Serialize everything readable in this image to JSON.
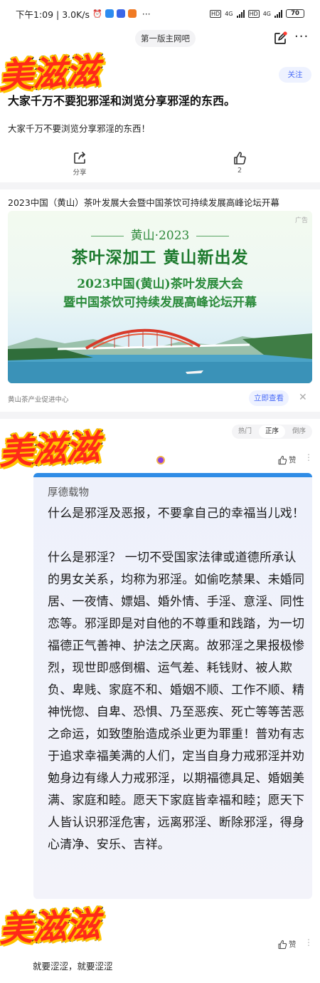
{
  "status_bar": {
    "time_speed": "下午1:09 | 3.0K/s",
    "dots": "···",
    "network_a": "4G",
    "network_b": "4G",
    "battery": "70"
  },
  "nav": {
    "forum_name": "第一版主网吧",
    "more": "···"
  },
  "watermark": "美滋滋",
  "post": {
    "follow_label": "关注",
    "title": "大家千万不要犯邪淫和浏览分享邪淫的东西。",
    "body": "大家千万不要浏览分享邪淫的东西！",
    "share_label": "分享",
    "like_count": "2"
  },
  "ad": {
    "title": "2023中国（黄山）茶叶发展大会暨中国茶饮可持续发展高峰论坛开幕",
    "tag": "广告",
    "banner_line1": "黄山·2023",
    "banner_line2": "茶叶深加工 黄山新出发",
    "banner_line3": "2023中国(黄山)茶叶发展大会",
    "banner_line4": "暨中国茶饮可持续发展高峰论坛开幕",
    "source": "黄山茶产业促进中心",
    "cta": "立即查看",
    "close": "✕"
  },
  "comments_header": {
    "sort_options": [
      "热门",
      "正序",
      "倒序"
    ],
    "active_sort": "正序"
  },
  "first_reply": {
    "like_label": "赞",
    "more": "⋮",
    "quote_heading": "厚德载物",
    "paragraph1": "什么是邪淫及恶报，不要拿自己的幸福当儿戏！",
    "paragraph2": "什么是邪淫？ 一切不受国家法律或道德所承认的男女关系，均称为邪淫。如偷吃禁果、未婚同居、一夜情、嫖娼、婚外情、手淫、意淫、同性恋等。邪淫即是对自他的不尊重和践踏，为一切福德正气善神、护法之厌离。故邪淫之果报极惨烈，现世即感倒楣、运气差、耗钱财、被人欺负、卑贱、家庭不和、婚姻不顺、工作不顺、精神恍惚、自卑、恐惧、乃至恶疾、死亡等等苦恶之命运，如致堕胎造成杀业更为罪重！普劝有志于追求幸福美满的人们，定当自身力戒邪淫并劝勉身边有缘人力戒邪淫，以期福德具足、婚姻美满、家庭和睦。愿天下家庭皆幸福和睦；愿天下人皆认识邪淫危害，远离邪淫、断除邪淫，得身心清净、安乐、吉祥。"
  },
  "second_reply": {
    "like_label": "赞",
    "more": "⋮",
    "text": "就要涩涩，就要涩涩"
  },
  "colors": {
    "accent": "#4a6cf7",
    "quote_border": "#2f8ce6",
    "watermark_red": "#ff2a18",
    "watermark_yellow": "#ffc400"
  }
}
